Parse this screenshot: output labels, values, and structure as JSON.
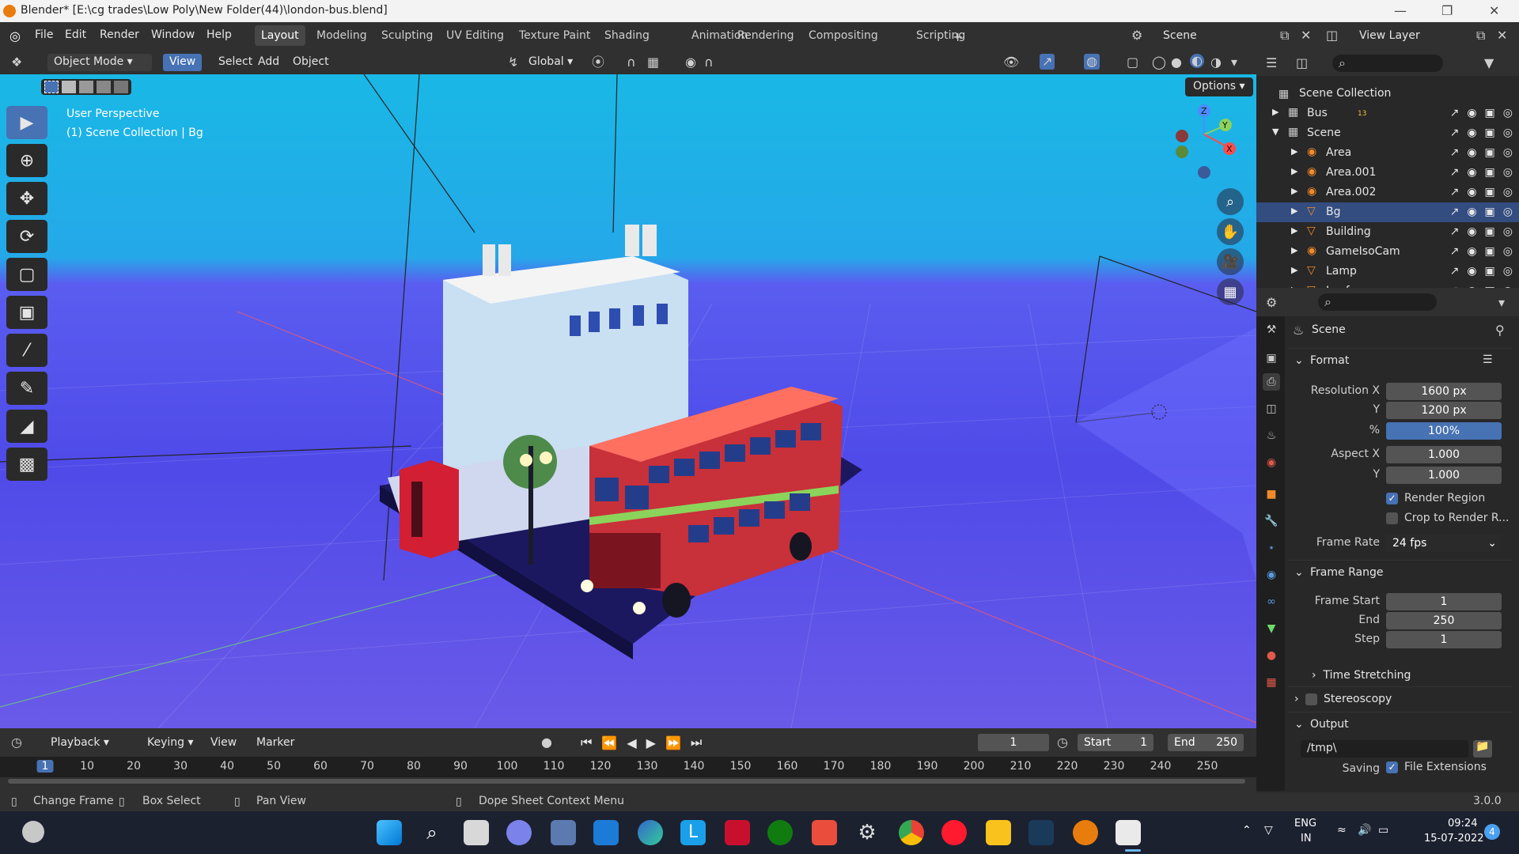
{
  "window": {
    "title": "Blender* [E:\\cg trades\\Low Poly\\New Folder(44)\\london-bus.blend]"
  },
  "menu": [
    "File",
    "Edit",
    "Render",
    "Window",
    "Help"
  ],
  "workspaces": [
    "Layout",
    "Modeling",
    "Sculpting",
    "UV Editing",
    "Texture Paint",
    "Shading",
    "Animation",
    "Rendering",
    "Compositing",
    "Scripting",
    "+"
  ],
  "active_workspace": "Layout",
  "scene_field": "Scene",
  "viewlayer_field": "View Layer",
  "header": {
    "mode": "Object Mode",
    "view": "View",
    "select": "Select",
    "add": "Add",
    "object": "Object",
    "orientation": "Global",
    "options": "Options"
  },
  "viewport": {
    "line1": "User Perspective",
    "line2": "(1) Scene Collection | Bg"
  },
  "outliner": {
    "root": "Scene Collection",
    "rows": [
      {
        "name": "Bus",
        "level": 0,
        "badge": "13"
      },
      {
        "name": "Scene",
        "level": 0
      },
      {
        "name": "Area",
        "level": 1
      },
      {
        "name": "Area.001",
        "level": 1
      },
      {
        "name": "Area.002",
        "level": 1
      },
      {
        "name": "Bg",
        "level": 1,
        "selected": true
      },
      {
        "name": "Building",
        "level": 1
      },
      {
        "name": "GameIsoCam",
        "level": 1
      },
      {
        "name": "Lamp",
        "level": 1
      },
      {
        "name": "Leaf",
        "level": 1
      }
    ]
  },
  "properties": {
    "context": "Scene",
    "format": {
      "title": "Format",
      "res_x_label": "Resolution X",
      "res_x": "1600 px",
      "res_y_label": "Y",
      "res_y": "1200 px",
      "pct_label": "%",
      "pct": "100%",
      "aspect_x_label": "Aspect X",
      "aspect_x": "1.000",
      "aspect_y_label": "Y",
      "aspect_y": "1.000",
      "render_region": "Render Region",
      "crop": "Crop to Render R...",
      "fps_label": "Frame Rate",
      "fps": "24 fps"
    },
    "frame_range": {
      "title": "Frame Range",
      "start_label": "Frame Start",
      "start": "1",
      "end_label": "End",
      "end": "250",
      "step_label": "Step",
      "step": "1"
    },
    "time_stretching": "Time Stretching",
    "stereoscopy": "Stereoscopy",
    "output": {
      "title": "Output",
      "path": "/tmp\\",
      "saving": "Saving",
      "file_ext": "File Extensions"
    }
  },
  "timeline": {
    "menus": [
      "Playback",
      "Keying",
      "View",
      "Marker"
    ],
    "current_frame": "1",
    "start_label": "Start",
    "start": "1",
    "end_label": "End",
    "end": "250",
    "ticks": [
      "1",
      "10",
      "20",
      "30",
      "40",
      "50",
      "60",
      "70",
      "80",
      "90",
      "100",
      "110",
      "120",
      "130",
      "140",
      "150",
      "160",
      "170",
      "180",
      "190",
      "200",
      "210",
      "220",
      "230",
      "240",
      "250"
    ]
  },
  "status": {
    "change_frame": "Change Frame",
    "box_select": "Box Select",
    "pan_view": "Pan View",
    "context_menu": "Dope Sheet Context Menu",
    "version": "3.0.0"
  },
  "taskbar": {
    "lang1": "ENG",
    "lang2": "IN",
    "time": "09:24",
    "date": "15-07-2022",
    "notif": "4"
  }
}
